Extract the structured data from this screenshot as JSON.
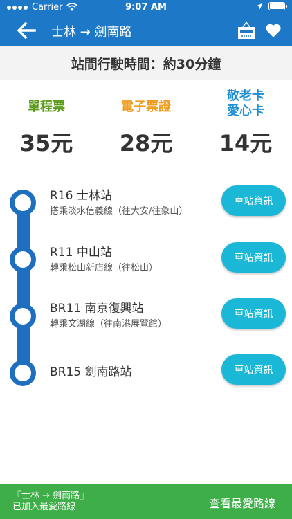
{
  "status_bar": {
    "carrier": "Carrier",
    "time": "9:07 AM"
  },
  "header": {
    "title": "士林 → 劍南路"
  },
  "travel_time": "站間行駛時間：約30分鐘",
  "fares": [
    {
      "label": "單程票",
      "value": "35元",
      "color": "#5a9a18"
    },
    {
      "label": "電子票證",
      "value": "28元",
      "color": "#f09a1a"
    },
    {
      "label": "敬老卡",
      "label2": "愛心卡",
      "value": "14元",
      "color": "#1e8fd6"
    }
  ],
  "stations": [
    {
      "name": "R16 士林站",
      "note": "搭乘淡水信義線（往大安/往象山）",
      "button": "車站資訊"
    },
    {
      "name": "R11 中山站",
      "note": "轉乘松山新店線（往松山）",
      "button": "車站資訊"
    },
    {
      "name": "BR11 南京復興站",
      "note": "轉乘文湖線（往南港展覽館）",
      "button": "車站資訊"
    },
    {
      "name": "BR15 劍南路站",
      "note": "",
      "button": "車站資訊"
    }
  ],
  "footer": {
    "message_line1": "『士林 → 劍南路』",
    "message_line2": "已加入最愛路線",
    "action": "查看最愛路線"
  },
  "colors": {
    "header": "#1e78c8",
    "line": "#1e6fbf",
    "button": "#1ab8d6",
    "footer": "#3dae48"
  }
}
